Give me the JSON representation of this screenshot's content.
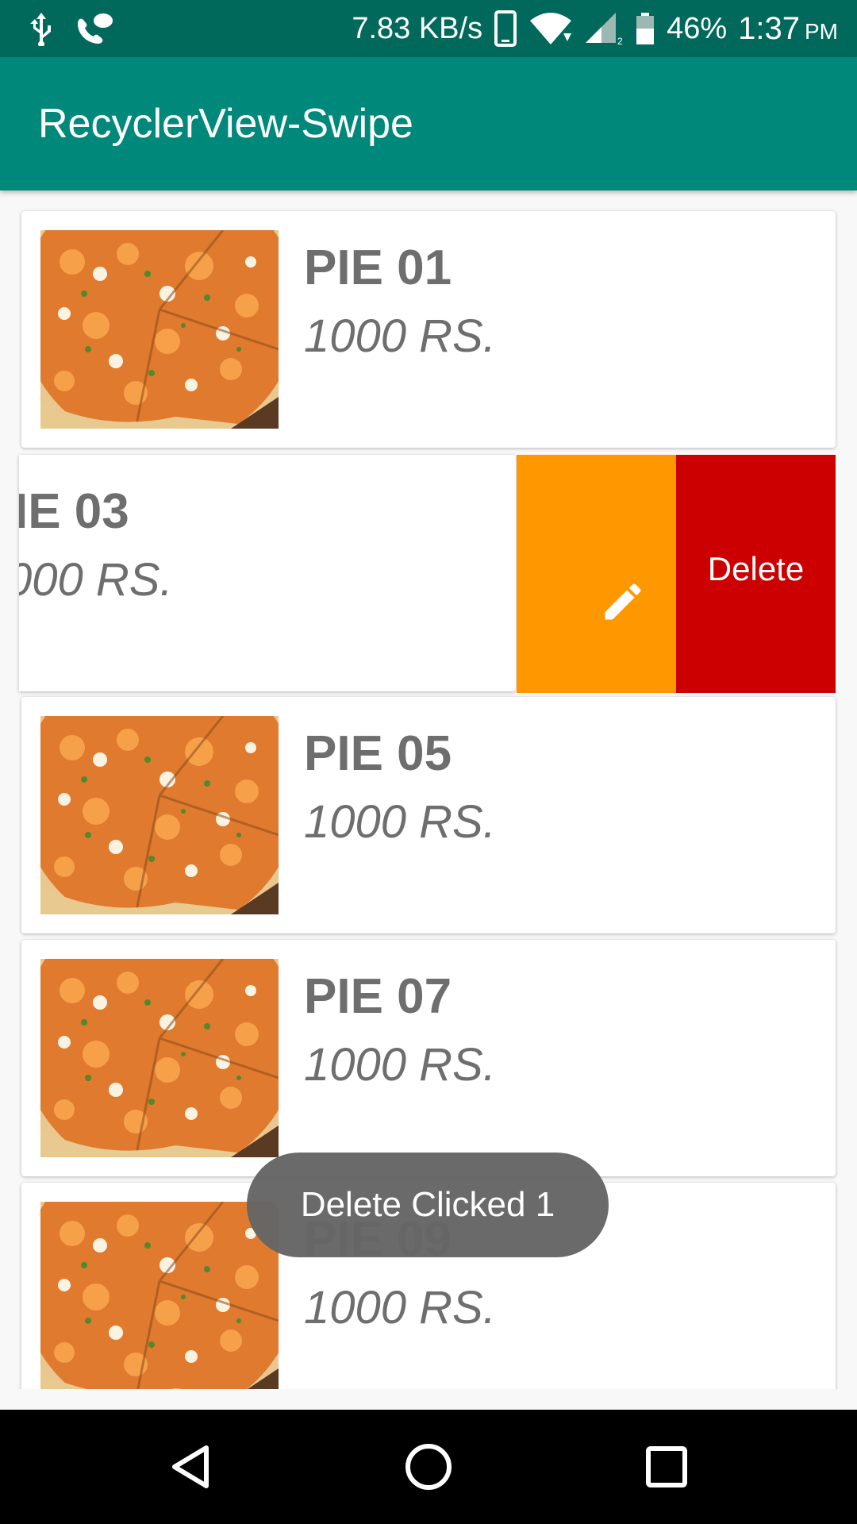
{
  "status_bar": {
    "net_speed": "7.83 KB/s",
    "battery": "46%",
    "time": "1:37",
    "ampm": "PM",
    "icons": [
      "usb-icon",
      "voicemail-icon",
      "phone-icon",
      "wifi-icon",
      "signal-icon",
      "battery-icon"
    ]
  },
  "app_bar": {
    "title": "RecyclerView-Swipe",
    "color": "#00897b"
  },
  "list": {
    "items": [
      {
        "name": "PIE 01",
        "price": "1000 RS."
      },
      {
        "name": "IE 03",
        "price": "000 RS."
      },
      {
        "name": "PIE 05",
        "price": "1000 RS."
      },
      {
        "name": "PIE 07",
        "price": "1000 RS."
      },
      {
        "name": "PIE 09",
        "price": "1000 RS."
      }
    ]
  },
  "swipe_actions": {
    "edit_icon": "pencil-icon",
    "edit_color": "#ff9800",
    "delete_label": "Delete",
    "delete_color": "#cc0000"
  },
  "toast": {
    "text": "Delete Clicked 1"
  },
  "nav_bar": {
    "icons": [
      "back-icon",
      "home-icon",
      "recents-icon"
    ]
  }
}
